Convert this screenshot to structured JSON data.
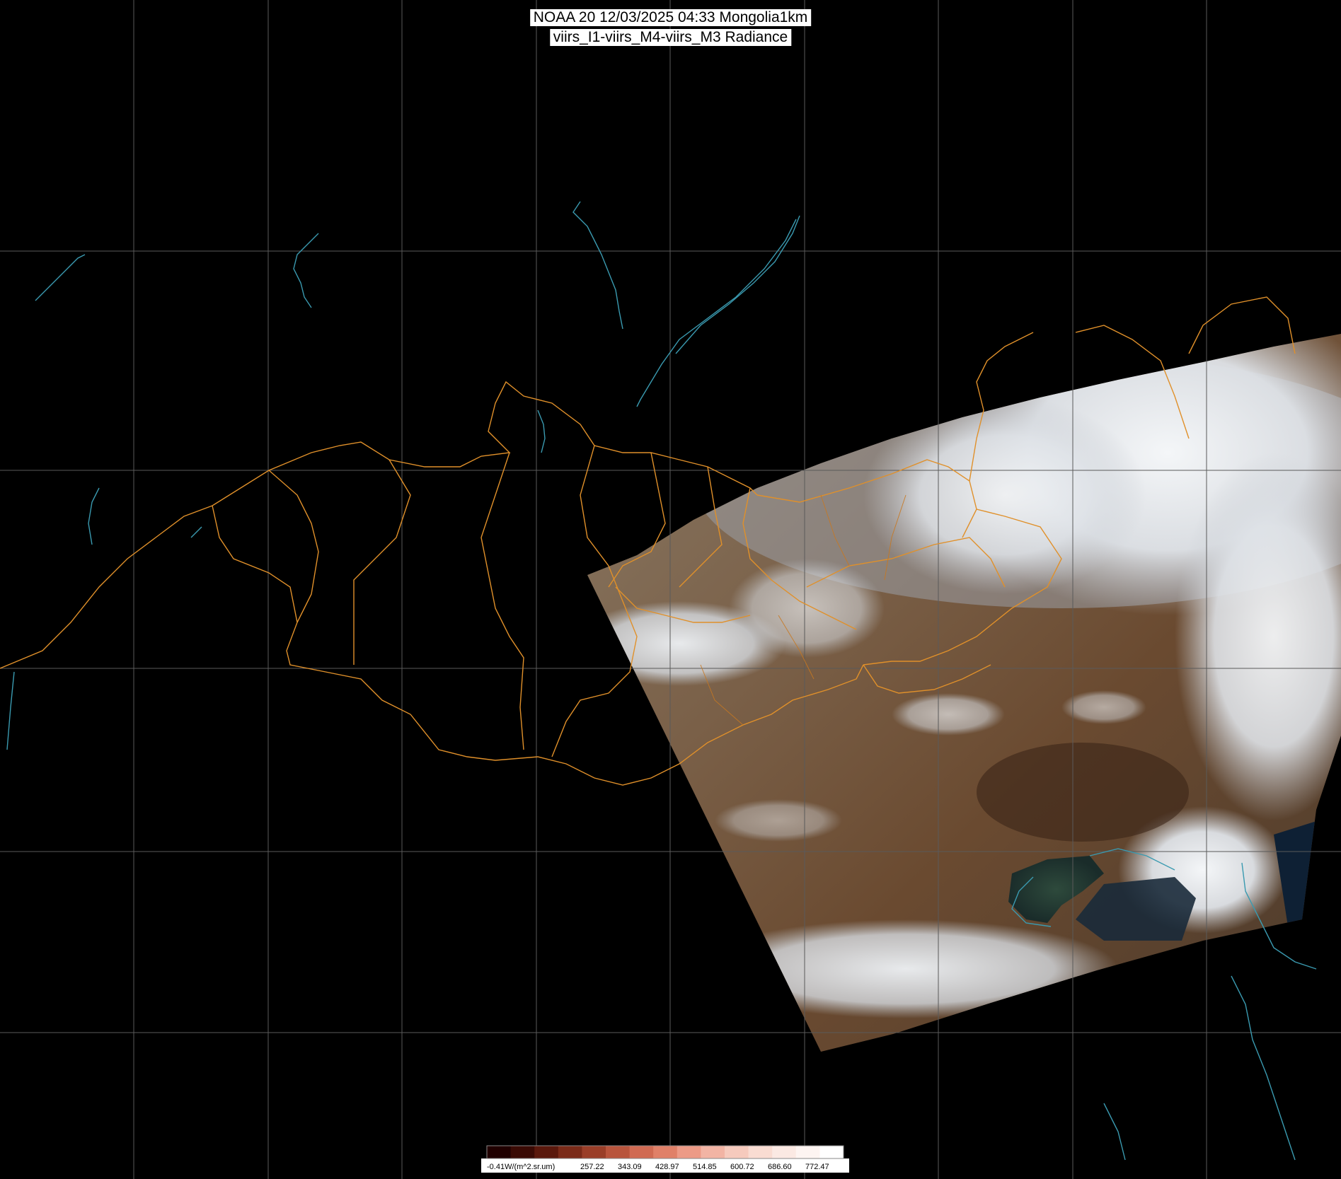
{
  "header": {
    "line1": "NOAA 20 12/03/2025 04:33 Mongolia1km",
    "line2": "viirs_I1-viirs_M4-viirs_M3 Radiance"
  },
  "colorbar": {
    "labels": [
      "-0.41W/(m^2.sr.um)",
      "257.22",
      "343.09",
      "428.97",
      "514.85",
      "600.72",
      "686.60",
      "772.47"
    ],
    "colors": [
      "#200000",
      "#3a0a04",
      "#5a180c",
      "#7a2a18",
      "#9a3e28",
      "#b8543c",
      "#d06a52",
      "#e08068",
      "#ec9a86",
      "#f2b4a4",
      "#f6cabd",
      "#f9dcd2",
      "#fbe9e3",
      "#fdf4f1",
      "#ffffff"
    ]
  },
  "colors": {
    "background": "#000000",
    "grid": "#5a5a5a",
    "borders": "#e0902a",
    "coast": "#3a9ab0"
  }
}
